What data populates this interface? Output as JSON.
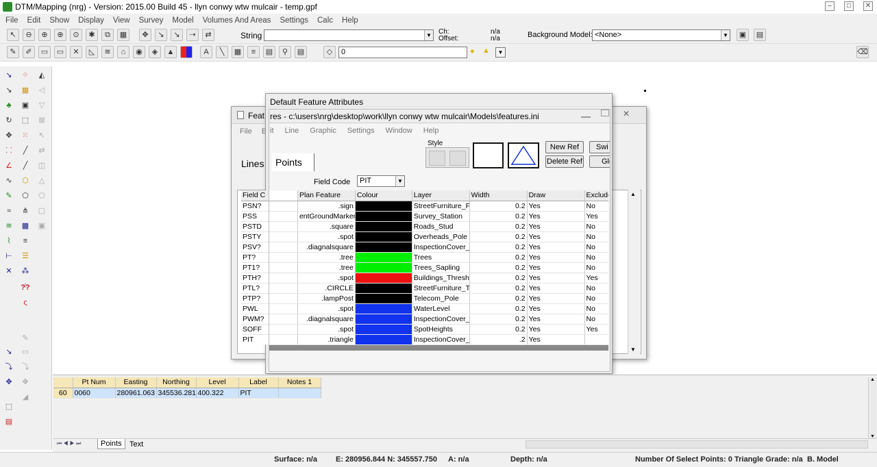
{
  "app": {
    "title": "DTM/Mapping (nrg) - Version: 2015.00 Build 45 - llyn conwy wtw mulcair - temp.gpf",
    "window_buttons": [
      "–",
      "□",
      "✕"
    ]
  },
  "menu": [
    "File",
    "Edit",
    "Show",
    "Display",
    "View",
    "Survey",
    "Model",
    "Volumes And Areas",
    "Settings",
    "Calc",
    "Help"
  ],
  "toolbar1": {
    "string_label": "String",
    "string_value": "",
    "ch_label": "Ch:",
    "offset_label": "Offset:",
    "ch_value": "n/a",
    "offset_value": "n/a",
    "bg_model_label": "Background Model:",
    "bg_model_value": "<None>"
  },
  "toolbar2": {
    "layer_value": "0"
  },
  "features_window": {
    "title": "Features - c:\\users\\nrg\\desktop\\work\\llyn conwy wtw mulcair\\Models\\features.ini",
    "title_visible": "Feat",
    "title_tail": "res - c:\\users\\nrg\\desktop\\work\\llyn conwy wtw mulcair\\Models\\features.ini",
    "menu": [
      "File",
      "Edit",
      "Line",
      "Graphic",
      "Settings",
      "Window",
      "Help"
    ],
    "menu_visible_edit": "E",
    "menu_visible_edit_tail": "it",
    "tab_lines": "Lines",
    "tab_points": "Points",
    "style_label": "Style",
    "buttons": {
      "new_ref": "New Ref",
      "delete_ref": "Delete Ref",
      "switch": "Switcher",
      "global": "Global"
    },
    "switch_visible": "Swi",
    "switch_tail": "her",
    "global_visible": "Glo",
    "global_tail": "al",
    "field_code_label": "Field Code",
    "field_code_value": "PIT",
    "columns": [
      "Field Code",
      "Plan Feature",
      "Colour",
      "Layer",
      "Width",
      "Draw",
      "Exclude from mo"
    ],
    "col_field_visible": "Field C",
    "col_field_tail": "de",
    "rows": [
      {
        "code": "PSN?",
        "plan": ".sign",
        "colour": "#000000",
        "layer": "StreetFurniture_F",
        "width": "0.2",
        "draw": "Yes",
        "exclude": "No"
      },
      {
        "code": "PSS",
        "plan": "entGroundMarker",
        "colour": "#000000",
        "layer": "Survey_Station",
        "width": "0.2",
        "draw": "Yes",
        "exclude": "Yes"
      },
      {
        "code": "PSTD",
        "plan": ".square",
        "colour": "#000000",
        "layer": "Roads_Stud",
        "width": "0.2",
        "draw": "Yes",
        "exclude": "No"
      },
      {
        "code": "PSTY",
        "plan": ".spot",
        "colour": "#000000",
        "layer": "Overheads_Pole",
        "width": "0.2",
        "draw": "Yes",
        "exclude": "No"
      },
      {
        "code": "PSV?",
        "plan": ".diagnalsquare",
        "colour": "#000000",
        "layer": "InspectionCover_",
        "width": "0.2",
        "draw": "Yes",
        "exclude": "No"
      },
      {
        "code": "PT?",
        "plan": ".tree",
        "colour": "#00ee00",
        "layer": "Trees",
        "width": "0.2",
        "draw": "Yes",
        "exclude": "No"
      },
      {
        "code": "PT1?",
        "plan": ".tree",
        "colour": "#00ee00",
        "layer": "Trees_Sapling",
        "width": "0.2",
        "draw": "Yes",
        "exclude": "No"
      },
      {
        "code": "PTH?",
        "plan": ".spot",
        "colour": "#ee1111",
        "layer": "Buildings_Thresh",
        "width": "0.2",
        "draw": "Yes",
        "exclude": "Yes"
      },
      {
        "code": "PTL?",
        "plan": ".CIRCLE",
        "colour": "#000000",
        "layer": "StreetFurniture_T",
        "width": "0.2",
        "draw": "Yes",
        "exclude": "No"
      },
      {
        "code": "PTP?",
        "plan": ".lampPost",
        "colour": "#000000",
        "layer": "Telecom_Pole",
        "width": "0.2",
        "draw": "Yes",
        "exclude": "No"
      },
      {
        "code": "PWL",
        "plan": ".spot",
        "colour": "#1133ee",
        "layer": "WaterLevel",
        "width": "0.2",
        "draw": "Yes",
        "exclude": "No"
      },
      {
        "code": "PWM?",
        "plan": ".diagnalsquare",
        "colour": "#1133ee",
        "layer": "InspectionCover_",
        "width": "0.2",
        "draw": "Yes",
        "exclude": "No"
      },
      {
        "code": "SOFF",
        "plan": ".spot",
        "colour": "#1133ee",
        "layer": "SpotHeights",
        "width": "0.2",
        "draw": "Yes",
        "exclude": "Yes"
      },
      {
        "code": "PIT",
        "plan": ".triangle",
        "colour": "#1133ee",
        "layer": "InspectionCover_",
        "width": ".2",
        "draw": "Yes",
        "exclude": ""
      }
    ]
  },
  "dialog": {
    "title": "Default Feature Attributes"
  },
  "points_table": {
    "columns": [
      "Pt Num",
      "Easting",
      "Northing",
      "Level",
      "Label",
      "Notes 1"
    ],
    "rows": [
      {
        "index": "60",
        "pt": "0060",
        "e": "280961.063",
        "n": "345536.281",
        "lvl": "400.322",
        "label": "PIT",
        "notes": ""
      }
    ],
    "tabs": [
      "Points",
      "Text"
    ]
  },
  "status": {
    "surface": "Surface: n/a",
    "coords": "E: 280956.844  N: 345557.750",
    "a": "A: n/a",
    "depth": "Depth: n/a",
    "select": "Number Of Select Points: 0",
    "triangle": "Triangle Grade: n/a",
    "bmodel": "B. Model"
  }
}
